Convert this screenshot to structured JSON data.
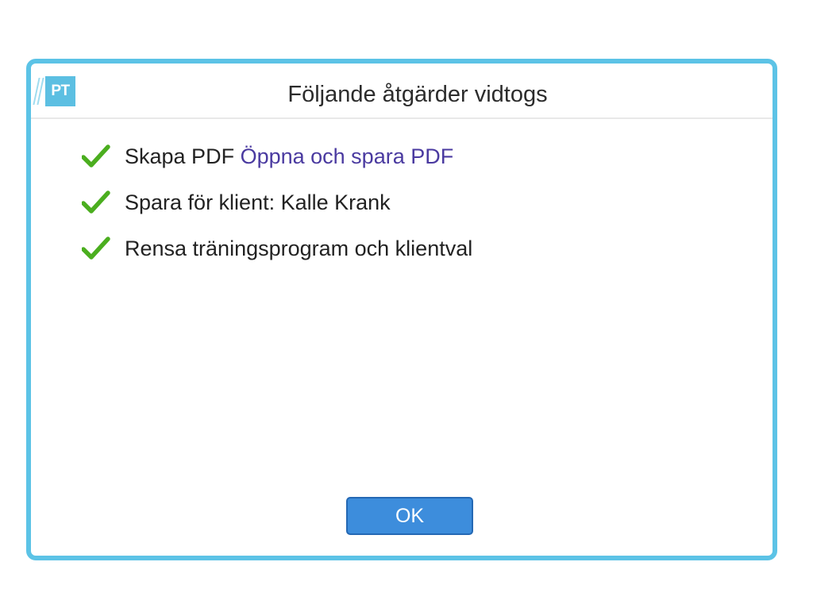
{
  "dialog": {
    "logo_text": "PT",
    "title": "Följande åtgärder vidtogs",
    "items": [
      {
        "icon": "check-icon",
        "text": "Skapa PDF",
        "link": "Öppna och spara PDF"
      },
      {
        "icon": "check-icon",
        "text": "Spara för klient: Kalle Krank"
      },
      {
        "icon": "check-icon",
        "text": "Rensa träningsprogram och klientval"
      }
    ],
    "ok_label": "OK"
  },
  "colors": {
    "border": "#5cc3e6",
    "logo": "#5cbfe2",
    "check": "#4bae1f",
    "link": "#4a3aa0",
    "button": "#3d8ddc"
  }
}
